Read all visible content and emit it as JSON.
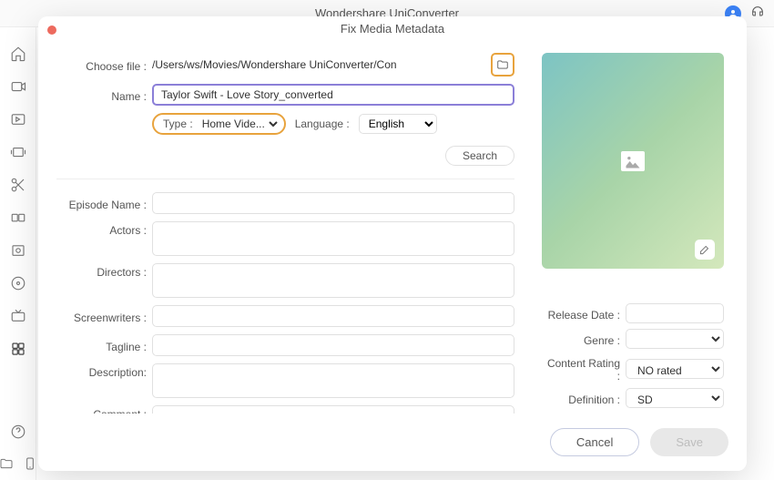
{
  "app_title": "Wondershare UniConverter",
  "modal_title": "Fix Media Metadata",
  "labels": {
    "choose_file": "Choose file :",
    "name": "Name :",
    "type": "Type :",
    "language": "Language :",
    "search": "Search",
    "episode_name": "Episode Name :",
    "actors": "Actors :",
    "directors": "Directors :",
    "screenwriters": "Screenwriters :",
    "tagline": "Tagline :",
    "description": "Description:",
    "comment": "Comment :",
    "release_date": "Release Date :",
    "genre": "Genre :",
    "content_rating": "Content Rating :",
    "definition": "Definition :",
    "cancel": "Cancel",
    "save": "Save"
  },
  "values": {
    "file_path": "/Users/ws/Movies/Wondershare UniConverter/Con",
    "name": "Taylor Swift - Love Story_converted",
    "type": "Home Vide...",
    "language": "English",
    "episode_name": "",
    "actors": "",
    "directors": "",
    "screenwriters": "",
    "tagline": "",
    "description": "",
    "comment": "",
    "release_date": "",
    "genre": "",
    "content_rating": "NO rated",
    "definition": "SD"
  }
}
